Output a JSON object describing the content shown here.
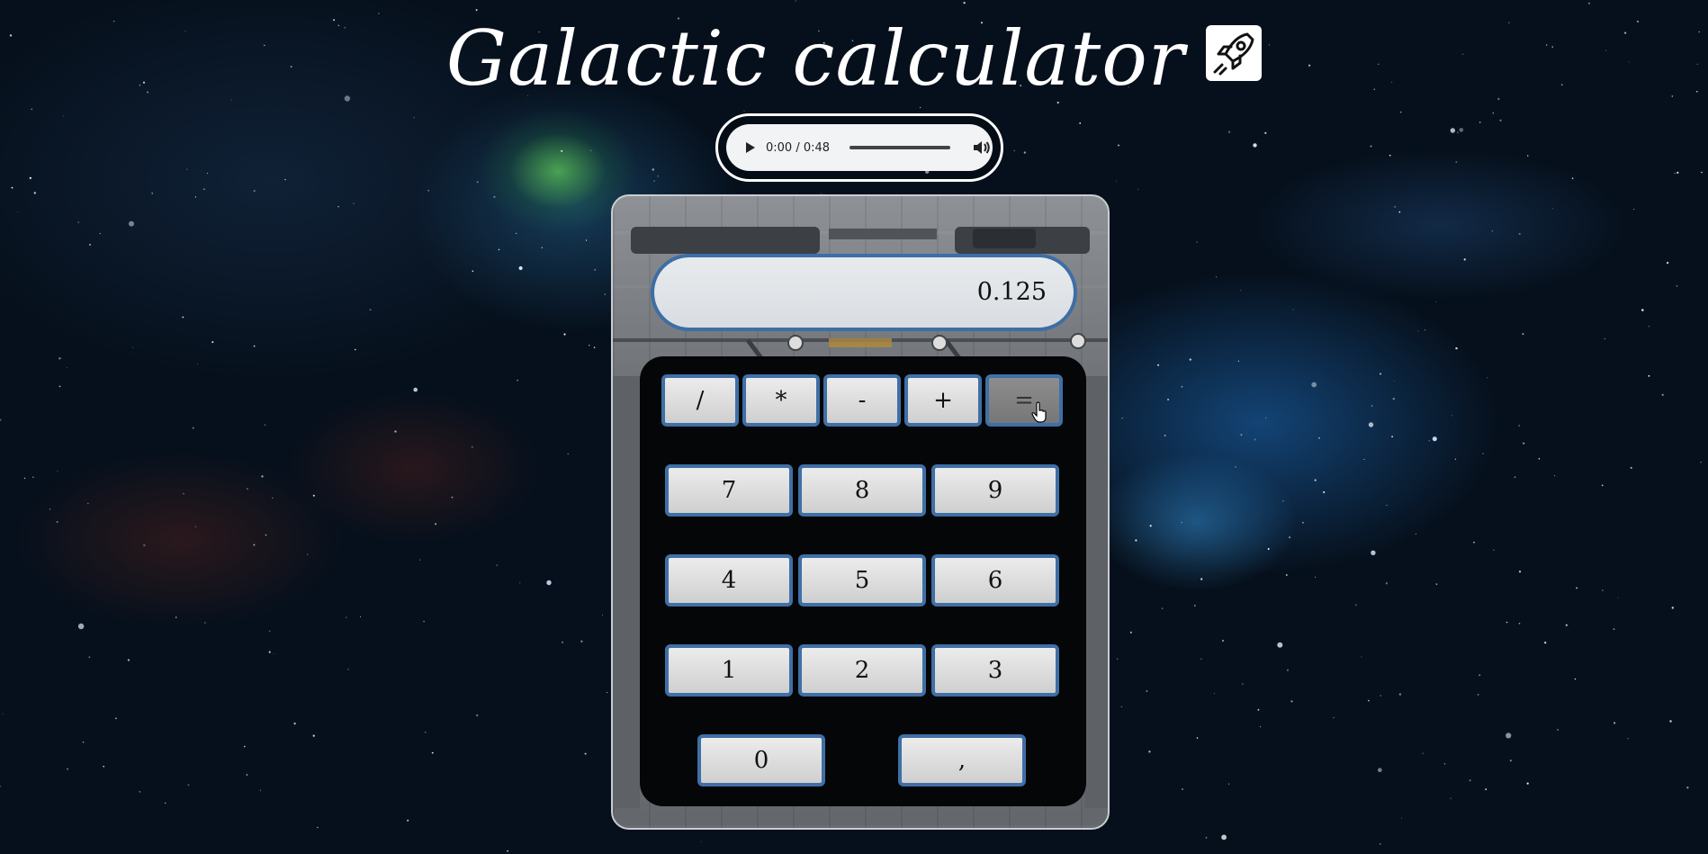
{
  "header": {
    "title": "Galactic calculator",
    "icon": "rocket-icon"
  },
  "audio_player": {
    "time": "0:00 / 0:48",
    "progress": 0.0
  },
  "calculator": {
    "display_value": "0.125",
    "operators": [
      "/",
      "*",
      "-",
      "+",
      "="
    ],
    "digits_rows": [
      [
        "7",
        "8",
        "9"
      ],
      [
        "4",
        "5",
        "6"
      ],
      [
        "1",
        "2",
        "3"
      ]
    ],
    "bottom_row": [
      "0",
      ","
    ],
    "pressed_key": "="
  },
  "colors": {
    "key_border": "#3f6fa6",
    "display_border": "#3d6ea5",
    "background": "#06101c"
  }
}
